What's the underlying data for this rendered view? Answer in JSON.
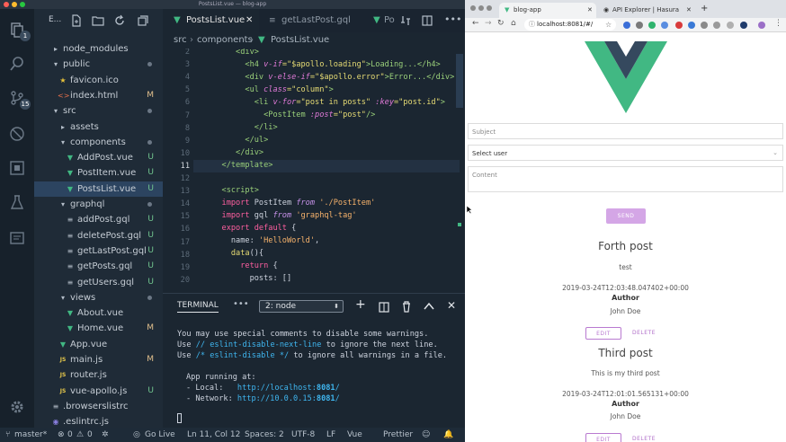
{
  "vscode": {
    "window_title": "PostsList.vue — blog-app",
    "explorer_label": "E...",
    "badges": {
      "explorer": "1",
      "scm": "15"
    },
    "tree": [
      {
        "label": "node_modules",
        "type": "folder-closed",
        "indent": 0,
        "status": ""
      },
      {
        "label": "public",
        "type": "folder-open",
        "indent": 0,
        "status": "dot"
      },
      {
        "label": "favicon.ico",
        "type": "star",
        "indent": 1,
        "status": ""
      },
      {
        "label": "index.html",
        "type": "html",
        "indent": 1,
        "status": "M"
      },
      {
        "label": "src",
        "type": "folder-open",
        "indent": 0,
        "status": "dot"
      },
      {
        "label": "assets",
        "type": "folder-closed",
        "indent": 1,
        "status": ""
      },
      {
        "label": "components",
        "type": "folder-open",
        "indent": 1,
        "status": "dot"
      },
      {
        "label": "AddPost.vue",
        "type": "vue",
        "indent": 2,
        "status": "U"
      },
      {
        "label": "PostItem.vue",
        "type": "vue",
        "indent": 2,
        "status": "U"
      },
      {
        "label": "PostsList.vue",
        "type": "vue",
        "indent": 2,
        "status": "U",
        "selected": true
      },
      {
        "label": "graphql",
        "type": "folder-open",
        "indent": 1,
        "status": "dot"
      },
      {
        "label": "addPost.gql",
        "type": "gql",
        "indent": 2,
        "status": "U"
      },
      {
        "label": "deletePost.gql",
        "type": "gql",
        "indent": 2,
        "status": "U"
      },
      {
        "label": "getLastPost.gql",
        "type": "gql",
        "indent": 2,
        "status": "U"
      },
      {
        "label": "getPosts.gql",
        "type": "gql",
        "indent": 2,
        "status": "U"
      },
      {
        "label": "getUsers.gql",
        "type": "gql",
        "indent": 2,
        "status": "U"
      },
      {
        "label": "views",
        "type": "folder-open",
        "indent": 1,
        "status": "dot"
      },
      {
        "label": "About.vue",
        "type": "vue",
        "indent": 2,
        "status": ""
      },
      {
        "label": "Home.vue",
        "type": "vue",
        "indent": 2,
        "status": "M"
      },
      {
        "label": "App.vue",
        "type": "vue",
        "indent": 1,
        "status": ""
      },
      {
        "label": "main.js",
        "type": "js",
        "indent": 1,
        "status": "M"
      },
      {
        "label": "router.js",
        "type": "js",
        "indent": 1,
        "status": ""
      },
      {
        "label": "vue-apollo.js",
        "type": "js",
        "indent": 1,
        "status": "U"
      },
      {
        "label": ".browserslistrc",
        "type": "file",
        "indent": 0,
        "status": ""
      },
      {
        "label": ".eslintrc.js",
        "type": "eslint",
        "indent": 0,
        "status": ""
      }
    ],
    "tabs": [
      {
        "label": "PostsList.vue",
        "active": true
      },
      {
        "label": "getLastPost.gql",
        "active": false
      },
      {
        "label": "Po",
        "active": false
      }
    ],
    "breadcrumb": [
      "src",
      "components",
      "PostsList.vue"
    ],
    "line_numbers": [
      "2",
      "3",
      "4",
      "5",
      "6",
      "7",
      "8",
      "9",
      "10",
      "11",
      "12",
      "13",
      "14",
      "15",
      "16",
      "17",
      "18",
      "19",
      "20"
    ],
    "code": {
      "l2": "<div>",
      "l3_open": "<h4 ",
      "l3_attr": "v-if",
      "l3_val": "=\"$apollo.loading\"",
      "l3_text": ">Loading...</h4>",
      "l4_open": "<div ",
      "l4_attr": "v-else-if",
      "l4_val": "=\"$apollo.error\"",
      "l4_text": ">Error...</div>",
      "l5_open": "<ul ",
      "l5_attr": "class",
      "l5_val": "=\"column\"",
      "l5_close": ">",
      "l6_open": "<li ",
      "l6_attr": "v-for",
      "l6_val": "=\"post in posts\" ",
      "l6_attr2": ":key",
      "l6_val2": "=\"post.id\"",
      "l6_close": ">",
      "l7_open": "<PostItem ",
      "l7_attr": ":post",
      "l7_val": "=\"post\"",
      "l7_close": "/>",
      "l8": "</li>",
      "l9": "</ul>",
      "l10": "</div>",
      "l11": "</template>",
      "l13": "<script>",
      "l14_k": "import",
      "l14_a": " PostItem ",
      "l14_from": "from",
      "l14_s": " './PostItem'",
      "l15_k": "import",
      "l15_a": " gql ",
      "l15_from": "from",
      "l15_s": " 'graphql-tag'",
      "l16_k": "export default",
      "l16_p": " {",
      "l17_a": "name",
      "l17_p": ": ",
      "l17_s": "'HelloWorld'",
      "l17_e": ",",
      "l18_a": "data",
      "l18_p": "(){",
      "l19_k": "return",
      "l19_p": " {",
      "l20_a": "posts",
      "l20_p": ": []"
    },
    "terminal_tab": "TERMINAL",
    "terminal_select": "2: node",
    "terminal_lines": {
      "t1": "You may use special comments to disable some warnings.",
      "t2a": "Use ",
      "t2b": "// eslint-disable-next-line",
      "t2c": " to ignore the next line.",
      "t3a": "Use ",
      "t3b": "/* eslint-disable */",
      "t3c": " to ignore all warnings in a file.",
      "t4": "App running at:",
      "t5a": "- Local:   ",
      "t5b": "http://localhost:",
      "t5c": "8081",
      "t5d": "/",
      "t6a": "- Network: ",
      "t6b": "http://10.0.0.15:",
      "t6c": "8081",
      "t6d": "/"
    },
    "status": {
      "branch": "master*",
      "errors": "0",
      "warnings": "0",
      "golive": "Go Live",
      "position": "Ln 11, Col 12",
      "spaces": "Spaces: 2",
      "encoding": "UTF-8",
      "eol": "LF",
      "language": "Vue",
      "formatter": "Prettier"
    }
  },
  "browser": {
    "tabs": [
      {
        "label": "blog-app",
        "active": true
      },
      {
        "label": "API Explorer | Hasura",
        "active": false
      }
    ],
    "url": "localhost:8081/#/",
    "form": {
      "subject_placeholder": "Subject",
      "user_select": "Select user",
      "content_placeholder": "Content",
      "send_label": "SEND"
    },
    "posts": [
      {
        "title": "Forth post",
        "body": "test",
        "date": "2019-03-24T12:03:48.047402+00:00",
        "author_label": "Author",
        "author": "John Doe",
        "edit": "EDIT",
        "delete": "DELETE"
      },
      {
        "title": "Third post",
        "body": "This is my third post",
        "date": "2019-03-24T12:01:01.565131+00:00",
        "author_label": "Author",
        "author": "John Doe",
        "edit": "EDIT",
        "delete": "DELETE"
      }
    ]
  },
  "colors": {
    "vue_green": "#41b883",
    "vue_dark": "#35495e",
    "accent_purple": "#d4a6e6",
    "delete_red": "#b06ec9"
  }
}
